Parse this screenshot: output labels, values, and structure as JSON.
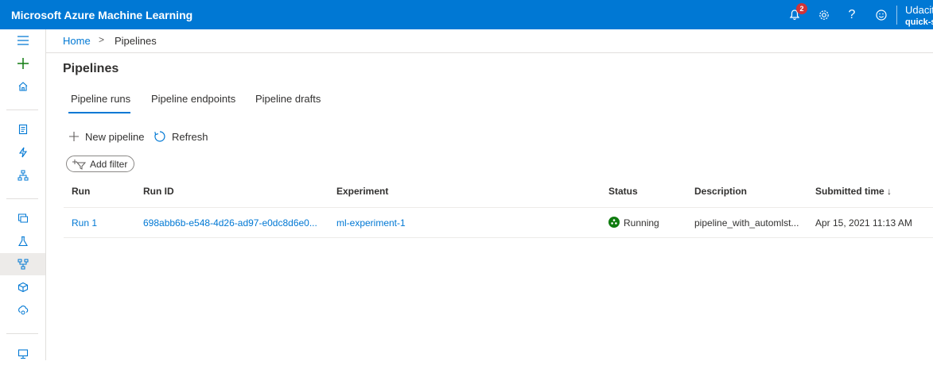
{
  "header": {
    "app_title": "Microsoft Azure Machine Learning",
    "notification_count": "2",
    "help_label": "?",
    "user_name": "Udacit",
    "workspace": "quick-s",
    "color": "#0078d4"
  },
  "breadcrumb": {
    "home": "Home",
    "separator": ">",
    "current": "Pipelines"
  },
  "page": {
    "title": "Pipelines"
  },
  "tabs": [
    {
      "label": "Pipeline runs",
      "active": true
    },
    {
      "label": "Pipeline endpoints",
      "active": false
    },
    {
      "label": "Pipeline drafts",
      "active": false
    }
  ],
  "commands": {
    "new_pipeline": "New pipeline",
    "refresh": "Refresh",
    "add_filter": "Add filter"
  },
  "table": {
    "columns": [
      "Run",
      "Run ID",
      "Experiment",
      "Status",
      "Description",
      "Submitted time ↓"
    ],
    "rows": [
      {
        "run": "Run 1",
        "run_id": "698abb6b-e548-4d26-ad97-e0dc8d6e0...",
        "experiment": "ml-experiment-1",
        "status": "Running",
        "description": "pipeline_with_automlst...",
        "submitted_time": "Apr 15, 2021 11:13 AM"
      }
    ]
  },
  "nav": {
    "icons": [
      "hamburger-icon",
      "plus-icon",
      "home-icon",
      "notebook-icon",
      "automl-icon",
      "designer-icon",
      "datasets-icon",
      "experiments-icon",
      "pipelines-icon",
      "models-icon",
      "endpoints-icon",
      "compute-icon"
    ],
    "active": "pipelines-icon"
  },
  "colors": {
    "accent": "#0078d4",
    "status_running": "#107c10",
    "badge": "#d13438"
  }
}
